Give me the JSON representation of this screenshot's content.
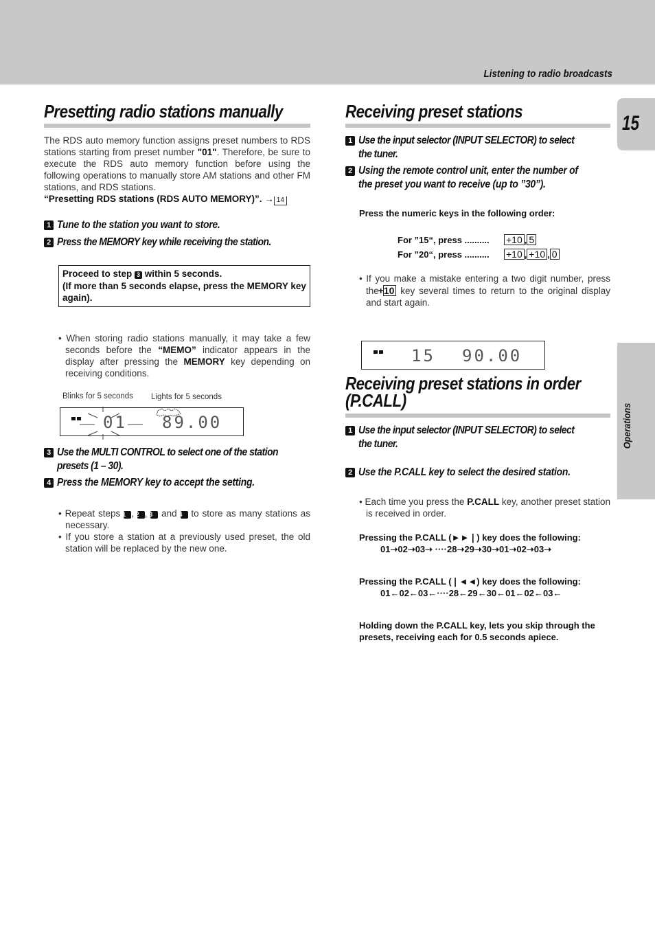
{
  "header": {
    "section": "Listening to radio broadcasts",
    "page_number": "15",
    "side_tab": "Operations"
  },
  "left": {
    "title": "Presetting radio stations manually",
    "intro": [
      {
        "t": "The RDS auto memory function assigns preset numbers to RDS stations starting from preset number ",
        "b": false
      },
      {
        "t": "\"01\"",
        "b": true
      },
      {
        "t": ".  Therefore, be sure to execute the RDS auto memory function before using the following operations to manually store AM stations and other FM stations, and RDS stations.",
        "b": false
      }
    ],
    "reference": "“Presetting RDS stations (RDS AUTO MEMORY)”.",
    "reference_page": "14",
    "steps": [
      {
        "n": "1",
        "text": "Tune to the station you want to store."
      },
      {
        "n": "2",
        "text": "Press the MEMORY key while receiving the station."
      },
      {
        "n": "3",
        "text": "Use the MULTI CONTROL to select one of the station presets (1 – 30)."
      },
      {
        "n": "4",
        "text": "Press the MEMORY key to accept the setting."
      }
    ],
    "note_box": {
      "line1a": "Proceed to step ",
      "line1n": "3",
      "line1b": " within 5 seconds.",
      "line2": "(If more than 5 seconds elapse, press the MEMORY key again)."
    },
    "bullet1": {
      "a": "When storing radio stations manually, it may take a few seconds before the ",
      "b1": "“MEMO”",
      "c": " indicator appears in the display after pressing the ",
      "b2": "MEMORY",
      "d": " key depending on receiving conditions."
    },
    "display": {
      "label_blink": "Blinks for 5 seconds",
      "label_light": "Lights for 5 seconds",
      "preset": "01",
      "frequency": "89.00"
    },
    "bullets_end": {
      "repeat_a": "Repeat steps ",
      "repeat_nums": [
        "1",
        "2",
        "3",
        "4"
      ],
      "repeat_and": "and",
      "repeat_b": " to store as many stations as necessary.",
      "replace": "If you store a station at a previously used preset, the old station will be replaced by the new one."
    }
  },
  "right": {
    "title1": "Receiving preset stations",
    "steps1": [
      {
        "n": "1",
        "text": "Use the input selector (INPUT SELECTOR) to select the tuner."
      },
      {
        "n": "2",
        "text": "Using the remote control unit, enter the number of the preset you want to receive (up to ”30”)."
      }
    ],
    "numeric_heading": "Press the numeric keys in the following order:",
    "examples": [
      {
        "label": "For ”15“, press ..........",
        "keys": [
          "+10",
          "5"
        ]
      },
      {
        "label": "For ”20“, press ..........",
        "keys": [
          "+10",
          "+10",
          "0"
        ]
      }
    ],
    "mistake": {
      "a": "If you make a mistake entering a two digit number, press the ",
      "key": "+10",
      "b": " key several times to return to the original display and start again."
    },
    "display": {
      "preset": "15",
      "frequency": "90.00"
    },
    "title2": "Receiving preset stations in order (P.CALL)",
    "steps2": [
      {
        "n": "1",
        "text": "Use the input selector (INPUT SELECTOR) to select the tuner."
      },
      {
        "n": "2",
        "text": "Use the P.CALL key to select the desired station."
      }
    ],
    "pcall_bullet": {
      "a": "Each time you press the ",
      "b": "P.CALL",
      "c": " key, another preset station is received in order."
    },
    "forward": {
      "heading": "Pressing the P.CALL (►►❘) key does the following:",
      "sequence": "01➝02➝03➝ ····28➝29➝30➝01➝02➝03➝"
    },
    "backward": {
      "heading": "Pressing the P.CALL (❘◄◄) key does the following:",
      "sequence": "01←02←03←····28←29←30←01←02←03←"
    },
    "holding": "Holding down the P.CALL key, lets you skip through the presets, receiving each for 0.5 seconds apiece."
  }
}
